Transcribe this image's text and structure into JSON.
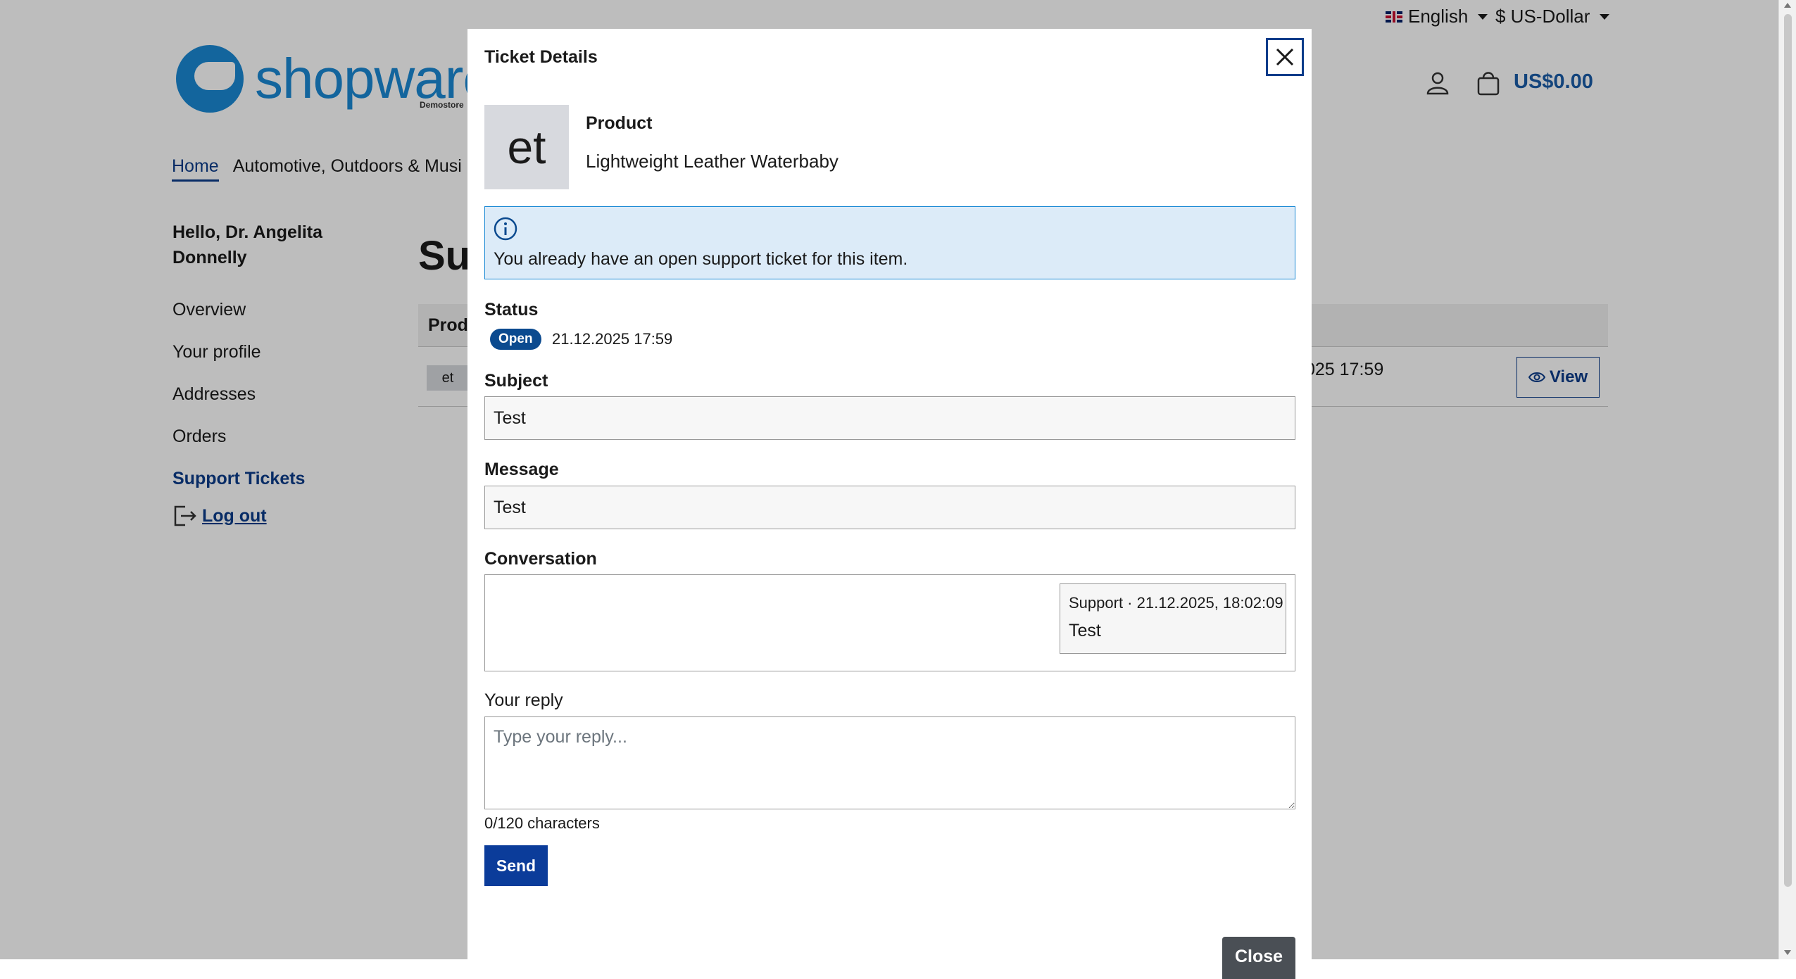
{
  "topbar": {
    "language": "English",
    "currency": "$ US-Dollar"
  },
  "header": {
    "logo_text": "shopware",
    "logo_sub": "Demostore",
    "cart_total": "US$0.00"
  },
  "nav": {
    "items": [
      "Home",
      "Automotive, Outdoors & Musi"
    ]
  },
  "sidebar": {
    "greeting": "Hello, Dr. Angelita Donnelly",
    "items": [
      "Overview",
      "Your profile",
      "Addresses",
      "Orders",
      "Support Tickets"
    ],
    "logout": "Log out"
  },
  "main": {
    "title": "Su",
    "table": {
      "header_product": "Produ",
      "row_thumb": "et",
      "row_date": "025 17:59",
      "view_label": "View"
    }
  },
  "modal": {
    "title": "Ticket Details",
    "product": {
      "thumb_text": "et",
      "label": "Product",
      "name": "Lightweight Leather Waterbaby"
    },
    "alert": "You already have an open support ticket for this item.",
    "status": {
      "label": "Status",
      "badge": "Open",
      "date": "21.12.2025 17:59"
    },
    "subject": {
      "label": "Subject",
      "value": "Test"
    },
    "message": {
      "label": "Message",
      "value": "Test"
    },
    "conversation": {
      "label": "Conversation",
      "messages": [
        {
          "meta": "Support · 21.12.2025, 18:02:09",
          "text": "Test"
        }
      ]
    },
    "reply": {
      "label": "Your reply",
      "placeholder": "Type your reply...",
      "char_count": "0/120 characters"
    },
    "send_label": "Send",
    "close_label": "Close"
  },
  "colors": {
    "accent": "#0b3c8a",
    "brand": "#1a89d4",
    "info_bg": "#dcebf8"
  },
  "icons": [
    "flag-uk-icon",
    "account-icon",
    "cart-icon",
    "logout-icon",
    "eye-icon",
    "close-icon",
    "info-icon"
  ]
}
